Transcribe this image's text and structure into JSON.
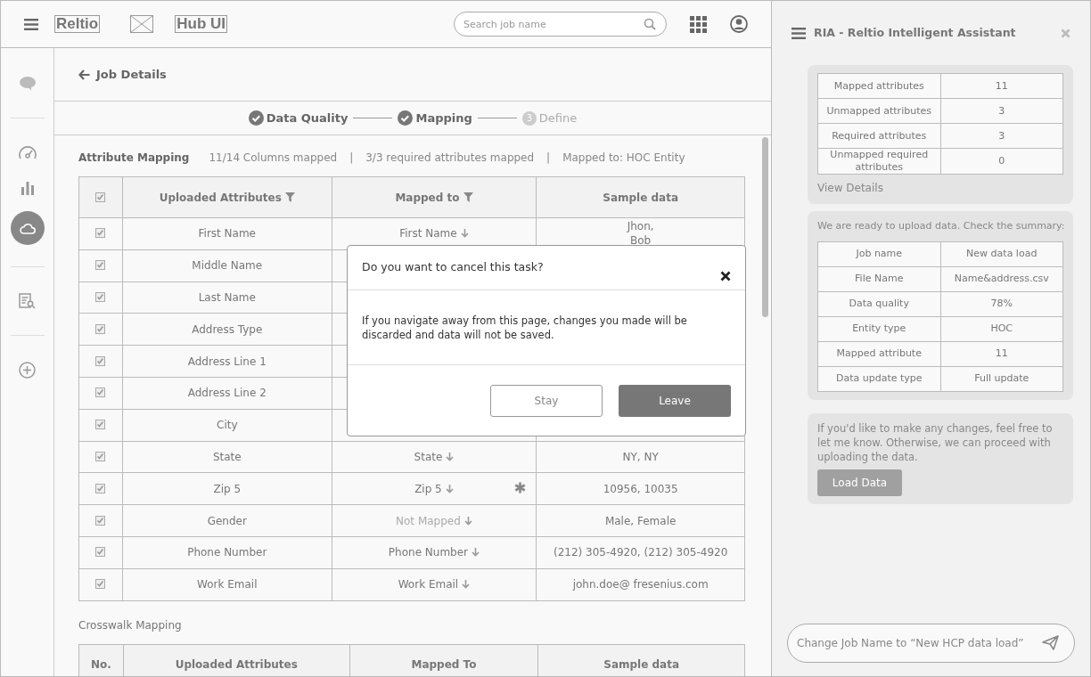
{
  "header": {
    "logo": "Reltio",
    "app_name": "Hub UI",
    "search": {
      "placeholder": "Search job name"
    }
  },
  "rail": [
    {
      "kind": "chat",
      "selected": false
    },
    {
      "kind": "divider"
    },
    {
      "kind": "gauge",
      "selected": false
    },
    {
      "kind": "chart",
      "selected": false
    },
    {
      "kind": "cloud",
      "selected": true
    },
    {
      "kind": "divider"
    },
    {
      "kind": "document-search",
      "selected": false
    },
    {
      "kind": "divider"
    },
    {
      "kind": "add",
      "selected": false
    }
  ],
  "page_title": "Job Details",
  "stepper": [
    {
      "label": "Data Quality",
      "done": true
    },
    {
      "label": "Mapping",
      "done": true
    },
    {
      "label": "Define",
      "number": "3",
      "done": false
    }
  ],
  "attribute_mapping": {
    "title": "Attribute Mapping",
    "stats": [
      "11/14 Columns mapped",
      "|",
      "3/3 required attributes mapped",
      "|",
      "Mapped to: HOC Entity"
    ],
    "header_checked": true,
    "columns": [
      {
        "label": "Uploaded Attributes",
        "filter": true
      },
      {
        "label": "Mapped to",
        "filter": true
      },
      {
        "label": "Sample data",
        "filter": false
      }
    ],
    "rows": [
      {
        "checked": true,
        "uploaded": "First Name",
        "mapped_to": "First Name",
        "mapped": true,
        "required": false,
        "sample": "Jhon,\nBob"
      },
      {
        "checked": true,
        "uploaded": "Middle Name"
      },
      {
        "checked": true,
        "uploaded": "Last Name"
      },
      {
        "checked": true,
        "uploaded": "Address Type"
      },
      {
        "checked": true,
        "uploaded": "Address Line 1"
      },
      {
        "checked": true,
        "uploaded": "Address Line 2"
      },
      {
        "checked": true,
        "uploaded": "City"
      },
      {
        "checked": true,
        "uploaded": "State",
        "mapped_to": "State",
        "mapped": true,
        "required": false,
        "sample": "NY, NY"
      },
      {
        "checked": true,
        "uploaded": "Zip 5",
        "mapped_to": "Zip 5",
        "mapped": true,
        "required": true,
        "sample": "10956, 10035"
      },
      {
        "checked": true,
        "uploaded": "Gender",
        "mapped_to": "Not Mapped",
        "mapped": false,
        "required": false,
        "sample": "Male, Female"
      },
      {
        "checked": true,
        "uploaded": "Phone Number",
        "mapped_to": "Phone Number",
        "mapped": true,
        "required": false,
        "sample": "(212) 305-4920, (212) 305-4920"
      },
      {
        "checked": true,
        "uploaded": "Work Email",
        "mapped_to": "Work Email",
        "mapped": true,
        "required": false,
        "sample": "john.doe@ fresenius.com"
      }
    ]
  },
  "crosswalk": {
    "title": "Crosswalk Mapping",
    "columns": [
      "No.",
      "Uploaded Attributes",
      "Mapped To",
      "Sample data"
    ]
  },
  "dialog": {
    "title": "Do you want to cancel this task?",
    "message": "If you navigate away from this page, changes you made will be discarded and data will not be saved.",
    "buttons": [
      {
        "label": "Stay",
        "primary": false
      },
      {
        "label": "Leave",
        "primary": true
      }
    ]
  },
  "assistant": {
    "title": "RIA - Reltio Intelligent Assistant",
    "messages": [
      {
        "kind": "table",
        "rows": [
          [
            "Mapped attributes",
            "11"
          ],
          [
            "Unmapped attributes",
            "3"
          ],
          [
            "Required attributes",
            "3"
          ],
          [
            "Unmapped required attributes",
            "0"
          ]
        ],
        "link": "View Details"
      },
      {
        "kind": "summary",
        "text": "We are ready to upload data. Check the summary:",
        "rows": [
          [
            "Job name",
            "New data load"
          ],
          [
            "File Name",
            "Name&address.csv"
          ],
          [
            "Data quality",
            "78%"
          ],
          [
            "Entity type",
            "HOC"
          ],
          [
            "Mapped attribute",
            "11"
          ],
          [
            "Data update type",
            "Full update"
          ]
        ]
      },
      {
        "kind": "action",
        "text": "If you'd like to make any changes, feel free to let me know. Otherwise, we can proceed with uploading the data.",
        "button": "Load Data"
      }
    ],
    "input": {
      "placeholder": "Change Job Name to “New HCP data load”"
    }
  }
}
